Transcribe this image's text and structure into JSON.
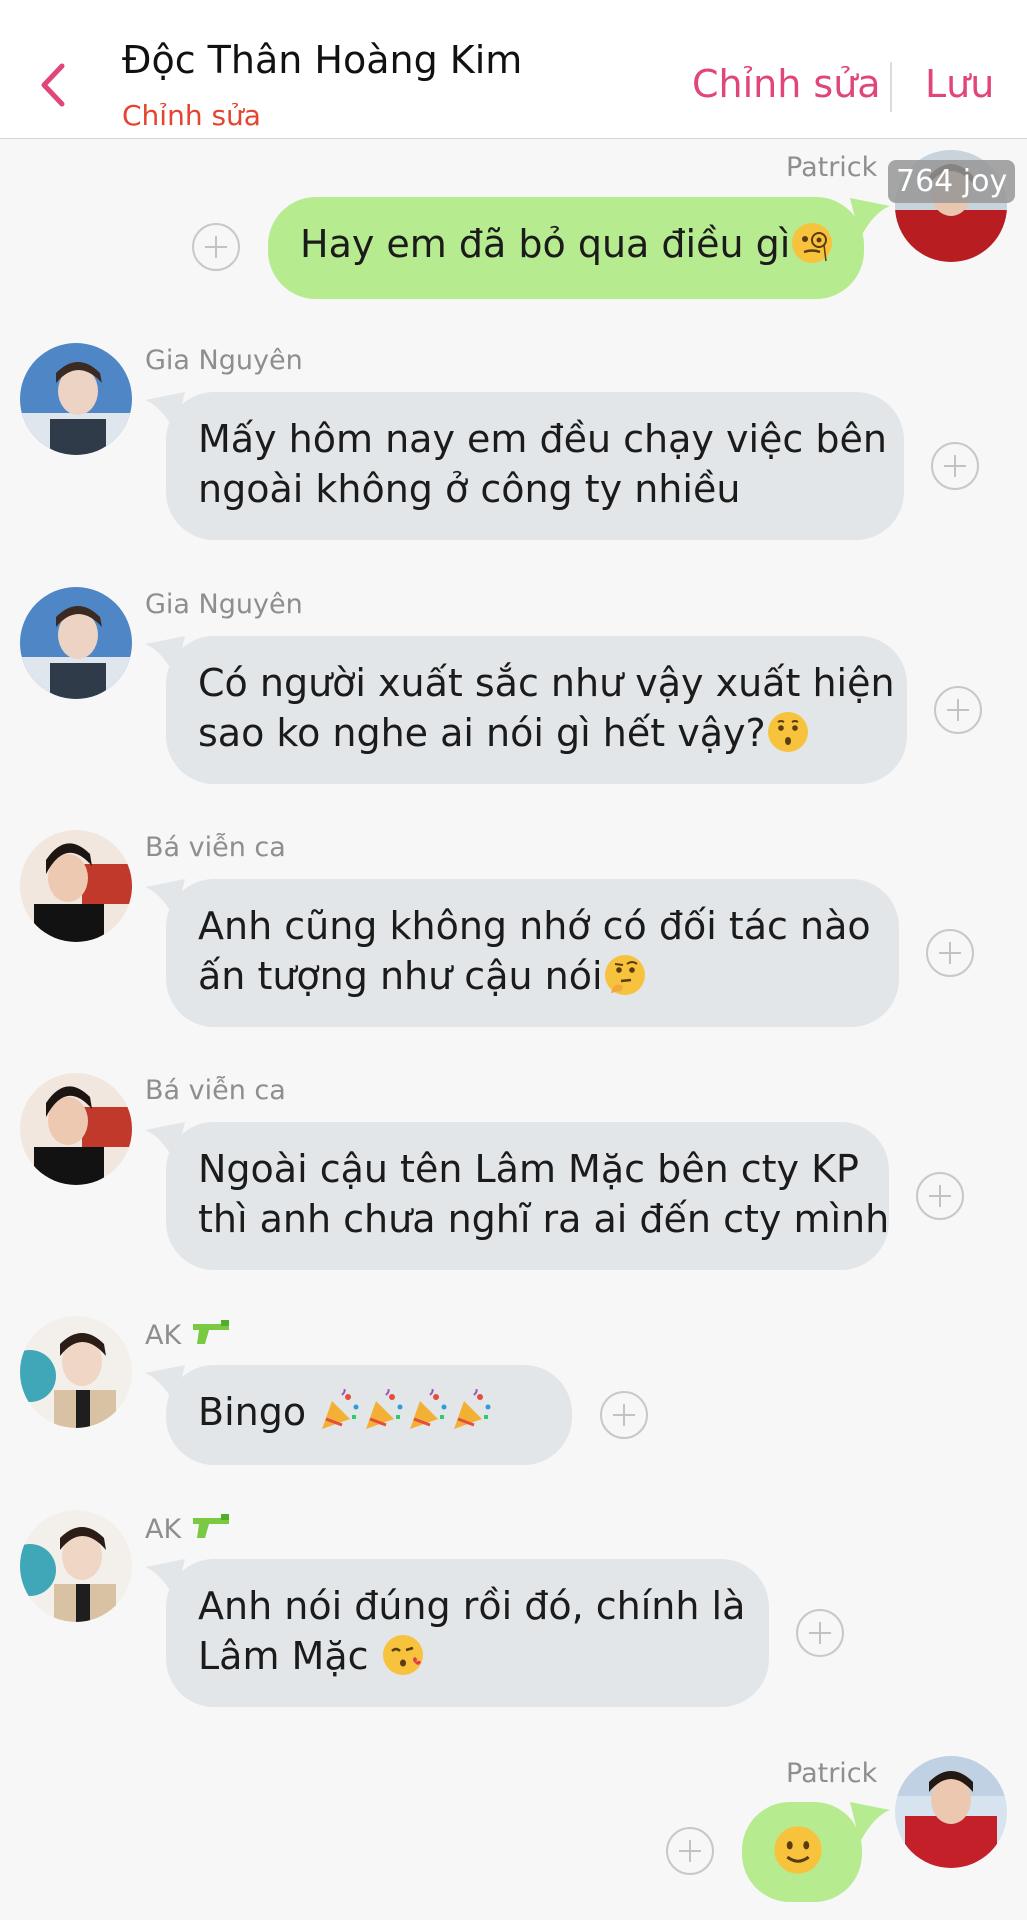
{
  "header": {
    "title": "Độc Thân Hoàng Kim",
    "subtitle": "Chỉnh sửa",
    "edit_label": "Chỉnh sửa",
    "save_label": "Lưu",
    "accent_color": "#e0457b",
    "subtitle_color": "#e5442f"
  },
  "messages": [
    {
      "sender": "Patrick",
      "direction": "outgoing",
      "badge": "764 joy",
      "lines": [
        "Hay em đã bỏ qua điều gì"
      ],
      "emoji": "monocle-face-icon"
    },
    {
      "sender": "Gia Nguyên",
      "direction": "incoming",
      "lines": [
        "Mấy hôm nay em đều chạy việc bên",
        "ngoài không ở công ty nhiều"
      ]
    },
    {
      "sender": "Gia Nguyên",
      "direction": "incoming",
      "lines": [
        "Có người xuất sắc như vậy xuất hiện",
        "sao ko nghe ai nói gì hết vậy?"
      ],
      "emoji": "kissing-face-icon"
    },
    {
      "sender": "Bá viễn ca",
      "direction": "incoming",
      "lines": [
        "Anh cũng không nhớ có đối tác nào",
        "ấn tượng như cậu nói"
      ],
      "emoji": "thinking-face-icon"
    },
    {
      "sender": "Bá viễn ca",
      "direction": "incoming",
      "lines": [
        "Ngoài cậu tên Lâm Mặc bên cty KP",
        "thì anh chưa nghĩ ra ai đến cty mình"
      ]
    },
    {
      "sender": "AK",
      "direction": "incoming",
      "lines": [
        "Bingo"
      ],
      "emoji": "party-popper-icon"
    },
    {
      "sender": "AK",
      "direction": "incoming",
      "lines": [
        "Anh nói đúng rồi đó, chính là",
        "Lâm Mặc"
      ],
      "emoji": "face-blowing-kiss-icon"
    },
    {
      "sender": "Patrick",
      "direction": "outgoing",
      "lines": [
        ""
      ],
      "emoji": "slightly-smiling-face-icon"
    }
  ],
  "colors": {
    "incoming_bubble": "#e3e6e8",
    "outgoing_bubble": "#b7eb8f",
    "sender_name": "#8e8e8e"
  }
}
